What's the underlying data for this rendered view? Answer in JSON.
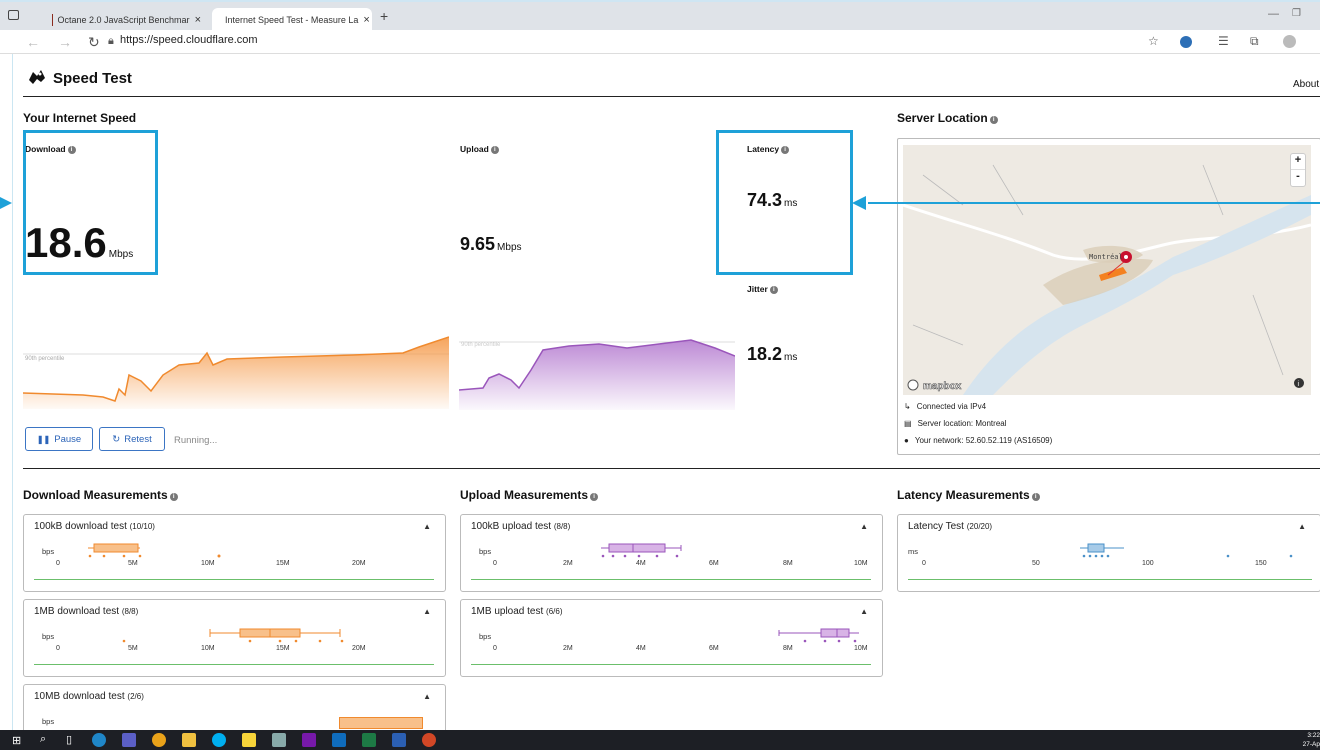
{
  "browser": {
    "tabs": [
      {
        "title": "Octane 2.0 JavaScript Benchmar",
        "close": "×"
      },
      {
        "title": "Internet Speed Test - Measure La",
        "close": "×"
      }
    ],
    "new_tab": "+",
    "url": "https://speed.cloudflare.com"
  },
  "header": {
    "title": "Speed Test",
    "about": "About"
  },
  "speed": {
    "section_title": "Your Internet Speed",
    "download": {
      "label": "Download",
      "value": "18.6",
      "unit": "Mbps",
      "percentile_label": "90th percentile"
    },
    "upload": {
      "label": "Upload",
      "value": "9.65",
      "unit": "Mbps",
      "percentile_label": "90th percentile"
    },
    "latency": {
      "label": "Latency",
      "value": "74.3",
      "unit": "ms"
    },
    "jitter": {
      "label": "Jitter",
      "value": "18.2",
      "unit": "ms"
    },
    "pause_label": "Pause",
    "retest_label": "Retest",
    "status": "Running..."
  },
  "server": {
    "section_title": "Server Location",
    "map_city_label": "Montréal",
    "zoom_in": "+",
    "zoom_out": "-",
    "mapbox_label": "mapbox",
    "connected": "Connected via IPv4",
    "location": "Server location: Montreal",
    "network": "Your network: 52.60.52.119 (AS16509)"
  },
  "download_measurements": {
    "title": "Download Measurements",
    "tests": [
      {
        "name": "100kB download test",
        "count": "(10/10)",
        "ticks": [
          "0",
          "5M",
          "10M",
          "15M",
          "20M"
        ]
      },
      {
        "name": "1MB download test",
        "count": "(8/8)",
        "ticks": [
          "0",
          "5M",
          "10M",
          "15M",
          "20M"
        ]
      },
      {
        "name": "10MB download test",
        "count": "(2/6)"
      }
    ],
    "unit": "bps"
  },
  "upload_measurements": {
    "title": "Upload Measurements",
    "tests": [
      {
        "name": "100kB upload test",
        "count": "(8/8)",
        "ticks": [
          "0",
          "2M",
          "4M",
          "6M",
          "8M",
          "10M"
        ]
      },
      {
        "name": "1MB upload test",
        "count": "(6/6)",
        "ticks": [
          "0",
          "2M",
          "4M",
          "6M",
          "8M",
          "10M"
        ]
      }
    ],
    "unit": "bps"
  },
  "latency_measurements": {
    "title": "Latency Measurements",
    "tests": [
      {
        "name": "Latency Test",
        "count": "(20/20)",
        "ticks": [
          "0",
          "50",
          "100",
          "150"
        ]
      }
    ],
    "unit": "ms"
  },
  "taskbar": {
    "time": "3:22",
    "date": "27-Ap"
  },
  "colors": {
    "download": "#f59a4a",
    "upload": "#b57cd0",
    "latency": "#4a90c8",
    "highlight": "#1ea1d8"
  }
}
